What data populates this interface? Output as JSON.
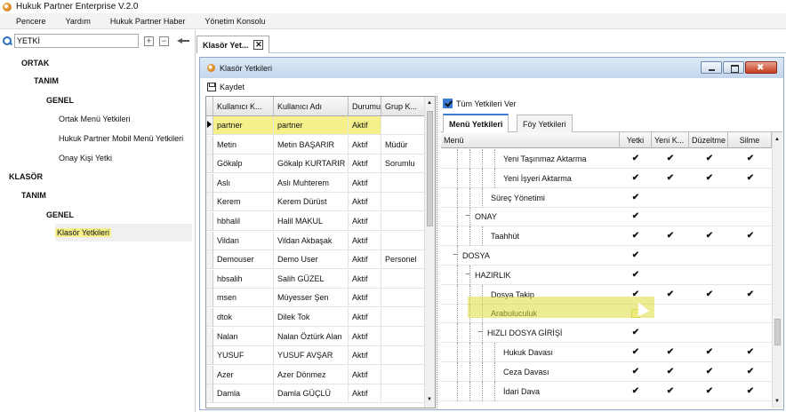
{
  "app": {
    "title": "Hukuk Partner Enterprise V.2.0"
  },
  "menu": [
    "Pencere",
    "Yardım",
    "Hukuk Partner Haber",
    "Yönetim Konsolu"
  ],
  "search": {
    "value": "YETKİ",
    "plus": "+",
    "minus": "−"
  },
  "main_tab": {
    "label": "Klasör Yet...",
    "close": "✕"
  },
  "tree": [
    {
      "label": "ORTAK",
      "bold": true
    },
    {
      "label": "TANIM",
      "bold": true
    },
    {
      "label": "GENEL",
      "bold": true
    },
    {
      "label": "Ortak Menü Yetkileri",
      "bold": false
    },
    {
      "label": "Hukuk Partner Mobil Menü Yetkileri",
      "bold": false
    },
    {
      "label": "Onay Kişi Yetki",
      "bold": false
    },
    {
      "label": "KLASÖR",
      "bold": true
    },
    {
      "label": "TANIM",
      "bold": true
    },
    {
      "label": "GENEL",
      "bold": true
    },
    {
      "label": "Klasör Yetkileri",
      "bold": false,
      "selected": true
    }
  ],
  "window": {
    "title": "Klasör Yetkileri",
    "save_label": "Kaydet"
  },
  "users_grid": {
    "columns": [
      "Kullanıcı K...",
      "Kullanıcı Adı",
      "Durumu",
      "Grup K..."
    ],
    "rows": [
      [
        "partner",
        "partner",
        "Aktif",
        ""
      ],
      [
        "Metin",
        "Metin BAŞARIR",
        "Aktif",
        "Müdür"
      ],
      [
        "Gökalp",
        "Gökalp KURTARIR",
        "Aktif",
        "Sorumlu"
      ],
      [
        "Aslı",
        "Aslı Muhterem",
        "Aktif",
        ""
      ],
      [
        "Kerem",
        "Kerem Dürüst",
        "Aktif",
        ""
      ],
      [
        "hbhalil",
        "Halil MAKUL",
        "Aktif",
        ""
      ],
      [
        "Vildan",
        "Vildan Akbaşak",
        "Aktif",
        ""
      ],
      [
        "Demouser",
        "Demo User",
        "Aktif",
        "Personel"
      ],
      [
        "hbsalih",
        "Salih GÜZEL",
        "Aktif",
        ""
      ],
      [
        "msen",
        "Müyesser Şen",
        "Aktif",
        ""
      ],
      [
        "dtok",
        "Dilek Tok",
        "Aktif",
        ""
      ],
      [
        "Nalan",
        "Nalan Öztürk Alan",
        "Aktif",
        ""
      ],
      [
        "YUSUF",
        "YUSUF AVŞAR",
        "Aktif",
        ""
      ],
      [
        "Azer",
        "Azer Dönmez",
        "Aktif",
        ""
      ],
      [
        "Damla",
        "Damla GÜÇLÜ",
        "Aktif",
        ""
      ]
    ]
  },
  "perm": {
    "all_label": "Tüm Yetkileri Ver",
    "tabs": [
      "Menü Yetkileri",
      "Föy Yetkileri"
    ],
    "columns": [
      "Menü",
      "Yetki",
      "Yeni K...",
      "Düzeltme",
      "Silme"
    ],
    "rows": [
      {
        "label": "Yeni Taşınmaz Aktarma",
        "indent": 3,
        "expand": "",
        "yetki": true,
        "yeni": true,
        "duzeltme": true,
        "silme": true
      },
      {
        "label": "Yeni İşyeri Aktarma",
        "indent": 3,
        "expand": "",
        "yetki": true,
        "yeni": true,
        "duzeltme": true,
        "silme": true
      },
      {
        "label": "Süreç Yönetimi",
        "indent": 2,
        "expand": "",
        "yetki": true,
        "yeni": false,
        "duzeltme": false,
        "silme": false
      },
      {
        "label": "ONAY",
        "indent": 1,
        "expand": "−",
        "yetki": true,
        "yeni": false,
        "duzeltme": false,
        "silme": false
      },
      {
        "label": "Taahhüt",
        "indent": 2,
        "expand": "",
        "yetki": true,
        "yeni": true,
        "duzeltme": true,
        "silme": true
      },
      {
        "label": "DOSYA",
        "indent": 0,
        "expand": "−",
        "yetki": true,
        "yeni": false,
        "duzeltme": false,
        "silme": false
      },
      {
        "label": "HAZIRLIK",
        "indent": 1,
        "expand": "−",
        "yetki": true,
        "yeni": false,
        "duzeltme": false,
        "silme": false
      },
      {
        "label": "Dosya Takip",
        "indent": 2,
        "expand": "",
        "yetki": true,
        "yeni": true,
        "duzeltme": true,
        "silme": true
      },
      {
        "label": "Arabuluculuk",
        "indent": 2,
        "expand": "",
        "yetki": false,
        "yeni": false,
        "duzeltme": false,
        "silme": false
      },
      {
        "label": "HIZLI DOSYA GİRİŞİ",
        "indent": 2,
        "expand": "−",
        "yetki": true,
        "yeni": false,
        "duzeltme": false,
        "silme": false
      },
      {
        "label": "Hukuk Davası",
        "indent": 3,
        "expand": "",
        "yetki": true,
        "yeni": true,
        "duzeltme": true,
        "silme": true
      },
      {
        "label": "Ceza Davası",
        "indent": 3,
        "expand": "",
        "yetki": true,
        "yeni": true,
        "duzeltme": true,
        "silme": true
      },
      {
        "label": "İdari Dava",
        "indent": 3,
        "expand": "",
        "yetki": true,
        "yeni": true,
        "duzeltme": true,
        "silme": true
      }
    ]
  },
  "colors": {
    "highlight": "#f5f089",
    "accent": "#3a7bd5",
    "close_red": "#c63b1f"
  },
  "icons": [
    "search-icon",
    "pin-icon",
    "save-icon",
    "app-icon",
    "minimize-icon",
    "maximize-icon",
    "close-icon",
    "cursor-icon"
  ]
}
